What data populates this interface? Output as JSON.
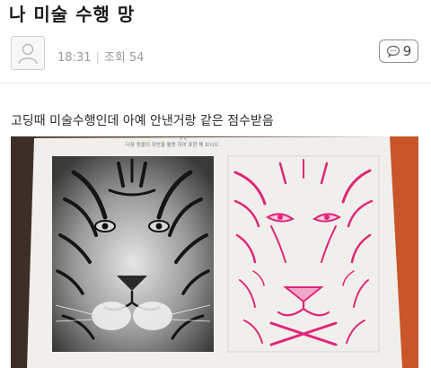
{
  "post": {
    "title": "나 미술 수행   망",
    "time": "18:31",
    "separator": "|",
    "views": "조회 54",
    "comment_count": "9",
    "body": "고딩때 미술수행인데 아예 안낸거랑 같은 점수받음"
  },
  "photo": {
    "worksheet_instruction": "다음 동물의 좌반을 활용 하여 표현 해 보시오."
  },
  "colors": {
    "accent": "#e0267a",
    "meta": "#9a9a9a"
  },
  "icons": {
    "avatar": "person-icon",
    "comments": "speech-bubble-icon"
  }
}
